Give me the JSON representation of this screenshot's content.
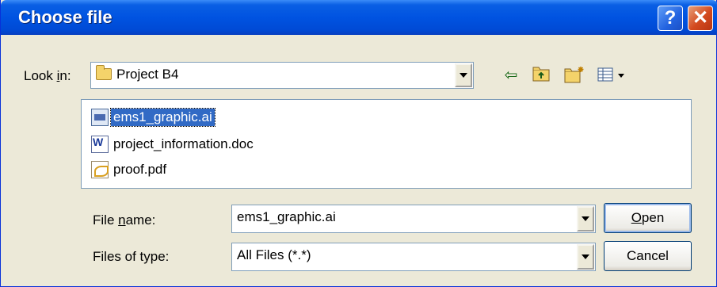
{
  "window": {
    "title": "Choose file",
    "help_label": "?",
    "close_label": "✕"
  },
  "look_in": {
    "label_pre": "Look ",
    "label_accel": "i",
    "label_post": "n:",
    "value": "Project B4"
  },
  "toolbar": {
    "back_icon": "back-arrow-icon",
    "up_icon": "up-folder-icon",
    "new_folder_icon": "new-folder-icon",
    "view_menu_icon": "view-menu-icon"
  },
  "files": [
    {
      "name": "ems1_graphic.ai",
      "icon": "illustrator-file-icon",
      "selected": true
    },
    {
      "name": "project_information.doc",
      "icon": "word-document-icon",
      "selected": false
    },
    {
      "name": "proof.pdf",
      "icon": "pdf-file-icon",
      "selected": false
    }
  ],
  "file_name": {
    "label_pre": "File ",
    "label_accel": "n",
    "label_post": "ame:",
    "value": "ems1_graphic.ai"
  },
  "file_type": {
    "label": "Files of type:",
    "value": "All Files (*.*)"
  },
  "buttons": {
    "open_accel": "O",
    "open_rest": "pen",
    "cancel": "Cancel"
  },
  "colors": {
    "title_bar": "#0053e1",
    "selection": "#316ac5",
    "dialog_bg": "#ece9d8"
  }
}
